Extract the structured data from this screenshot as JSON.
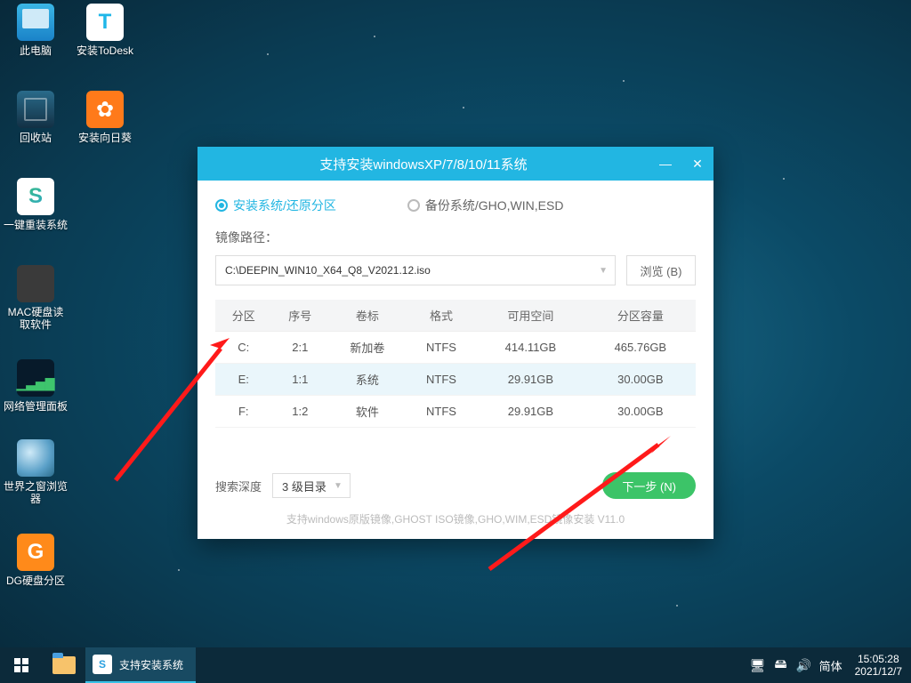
{
  "desktop_icons": [
    {
      "name": "此电脑"
    },
    {
      "name": "安装ToDesk"
    },
    {
      "name": "回收站"
    },
    {
      "name": "安装向日葵"
    },
    {
      "name": "一键重装系统"
    },
    {
      "name": "MAC硬盘读取软件"
    },
    {
      "name": "网络管理面板"
    },
    {
      "name": "世界之窗浏览器"
    },
    {
      "name": "DG硬盘分区"
    }
  ],
  "installer": {
    "title": "支持安装windowsXP/7/8/10/11系统",
    "radio_install": "安装系统/还原分区",
    "radio_backup": "备份系统/GHO,WIN,ESD",
    "path_label": "镜像路径：",
    "path_value": "C:\\DEEPIN_WIN10_X64_Q8_V2021.12.iso",
    "browse": "浏览 (B)",
    "table": {
      "headers": [
        "分区",
        "序号",
        "卷标",
        "格式",
        "可用空间",
        "分区容量"
      ],
      "rows": [
        {
          "drive": "C:",
          "index": "2:1",
          "label": "新加卷",
          "fs": "NTFS",
          "free": "414.11GB",
          "size": "465.76GB"
        },
        {
          "drive": "E:",
          "index": "1:1",
          "label": "系统",
          "fs": "NTFS",
          "free": "29.91GB",
          "size": "30.00GB"
        },
        {
          "drive": "F:",
          "index": "1:2",
          "label": "软件",
          "fs": "NTFS",
          "free": "29.91GB",
          "size": "30.00GB"
        }
      ]
    },
    "depth_label": "搜索深度",
    "depth_value": "3 级目录",
    "next": "下一步 (N)",
    "hint": "支持windows原版镜像,GHOST ISO镜像,GHO,WIM,ESD镜像安装 V11.0"
  },
  "taskbar": {
    "app_label": "支持安装系统",
    "ime": "简体",
    "time": "15:05:28",
    "date": "2021/12/7"
  }
}
